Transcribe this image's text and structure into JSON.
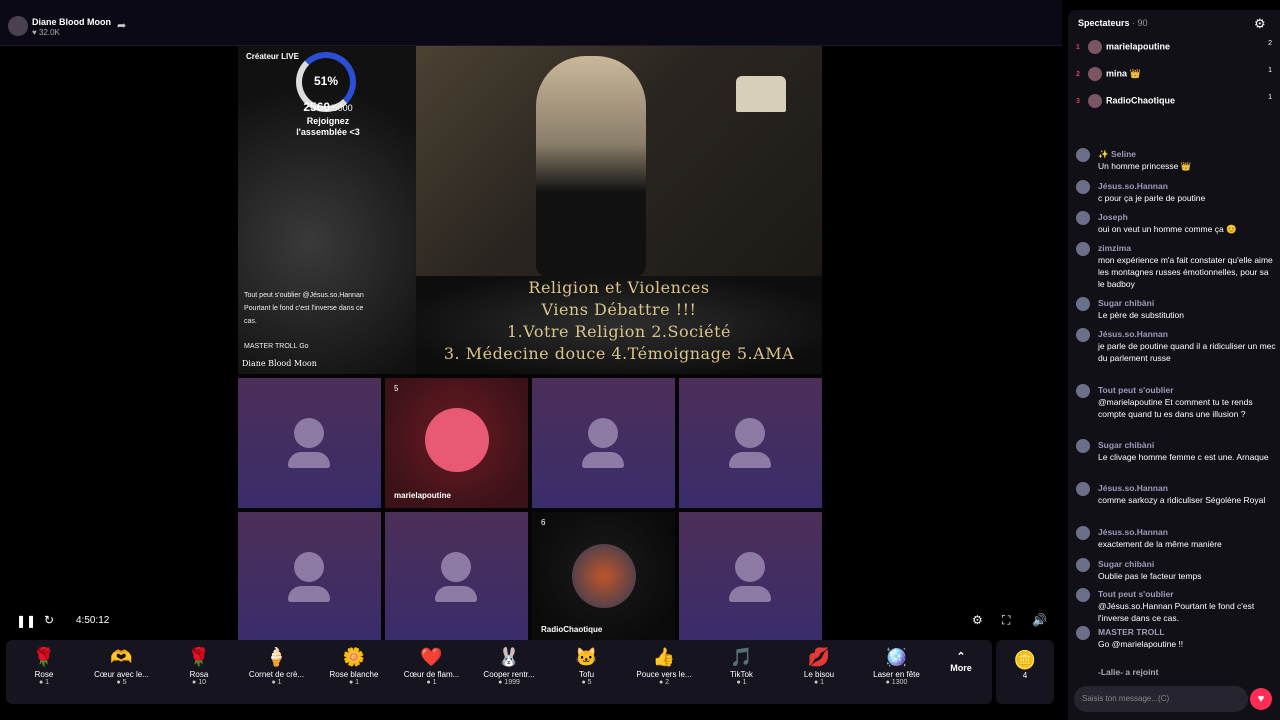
{
  "header": {
    "streamer": "Diane Blood Moon",
    "likes": "♥ 32.0K"
  },
  "hero": {
    "creator_label": "Créateur LIVE",
    "goal_pct": "51%",
    "goal_current": "2560",
    "goal_total": "/5000",
    "goal_text_1": "Rejoignez",
    "goal_text_2": "l'assemblée <3",
    "banner_lines": [
      "Religion et Violences",
      "Viens Débattre !!!",
      "1.Votre Religion 2.Société",
      "3. Médecine douce 4.Témoignage 5.AMA"
    ],
    "overlay_chat": [
      {
        "text": "Tout peut s'oublier @Jésus.so.Hannan"
      },
      {
        "text": "Pourtant le fond c'est l'inverse dans ce"
      },
      {
        "text": "cas."
      },
      {
        "text": "MASTER TROLL Go"
      }
    ],
    "caption": "Diane Blood Moon"
  },
  "tiles": [
    {
      "name": "",
      "badge": ""
    },
    {
      "name": "marielapoutine",
      "badge": "5"
    },
    {
      "name": "",
      "badge": ""
    },
    {
      "name": "",
      "badge": ""
    },
    {
      "name": "",
      "badge": ""
    },
    {
      "name": "",
      "badge": ""
    },
    {
      "name": "RadioChaotique",
      "badge": "6"
    },
    {
      "name": "",
      "badge": ""
    }
  ],
  "player": {
    "time": "4:50:12"
  },
  "gifts": [
    {
      "name": "Rose",
      "price": "1",
      "icon": "🌹"
    },
    {
      "name": "Cœur avec le...",
      "price": "5",
      "icon": "🫶"
    },
    {
      "name": "Rosa",
      "price": "10",
      "icon": "🌹"
    },
    {
      "name": "Cornet de crè...",
      "price": "1",
      "icon": "🍦"
    },
    {
      "name": "Rose blanche",
      "price": "1",
      "icon": "🌼"
    },
    {
      "name": "Cœur de flam...",
      "price": "1",
      "icon": "❤️"
    },
    {
      "name": "Cooper rentr...",
      "price": "1999",
      "icon": "🐰"
    },
    {
      "name": "Tofu",
      "price": "5",
      "icon": "🐱"
    },
    {
      "name": "Pouce vers le...",
      "price": "2",
      "icon": "👍"
    },
    {
      "name": "TikTok",
      "price": "1",
      "icon": "🎵"
    },
    {
      "name": "Le bisou",
      "price": "1",
      "icon": "💋"
    },
    {
      "name": "Laser en fête",
      "price": "1300",
      "icon": "🪩"
    }
  ],
  "more_label": "More",
  "coins": "4",
  "sidebar": {
    "title": "Spectateurs",
    "count": "· 90",
    "top": [
      {
        "rank": "1",
        "name": "marielapoutine",
        "score": "2"
      },
      {
        "rank": "2",
        "name": "mina 👑",
        "score": "1"
      },
      {
        "rank": "3",
        "name": "RadioChaotique",
        "score": "1"
      }
    ],
    "messages": [
      {
        "user": "✨ Seline",
        "text": "Un homme princesse 👑"
      },
      {
        "user": "Jésus.so.Hannan",
        "text": "c pour ça je parle de poutine"
      },
      {
        "user": "Joseph",
        "text": "oui on veut un homme comme ça 😊"
      },
      {
        "user": "zimzima",
        "text": "mon expérience m'a fait constater qu'elle aime les montagnes russes émotionnelles, pour sa le badboy"
      },
      {
        "user": "Sugar chibàni",
        "text": "Le père de substitution"
      },
      {
        "user": "Jésus.so.Hannan",
        "text": "je parle de poutine quand il a ridiculiser un mec du parlement russe"
      },
      {
        "user": "Tout peut s'oublier",
        "text": "@marielapoutine Et comment tu te rends compte quand tu es dans une illusion ?"
      },
      {
        "user": "Sugar chibàni",
        "text": "Le clivage homme femme c est une. Arnaque"
      },
      {
        "user": "Jésus.so.Hannan",
        "text": "comme sarkozy a ridiculiser Ségolène Royal"
      },
      {
        "user": "Jésus.so.Hannan",
        "text": "exactement de la même manière"
      },
      {
        "user": "Sugar chibàni",
        "text": "Oublie pas le facteur temps"
      },
      {
        "user": "Tout peut s'oublier",
        "text": "@Jésus.so.Hannan Pourtant le fond c'est l'inverse dans ce cas."
      },
      {
        "user": "MASTER TROLL",
        "text": "Go @marielapoutine !!"
      }
    ],
    "joined": "-Lalie- a rejoint",
    "input_placeholder": "Saisis ton message...(C)"
  }
}
